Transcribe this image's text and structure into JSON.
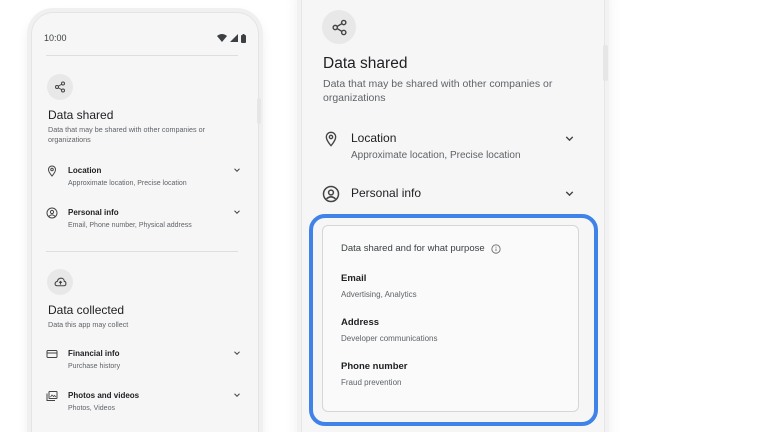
{
  "left_phone": {
    "status_time": "10:00",
    "data_shared": {
      "icon": "share-icon",
      "title": "Data shared",
      "subtitle": "Data that may be shared with other companies or organizations",
      "items": [
        {
          "icon": "location-pin-icon",
          "label": "Location",
          "detail": "Approximate location, Precise location"
        },
        {
          "icon": "account-circle-icon",
          "label": "Personal info",
          "detail": "Email, Phone number, Physical address"
        }
      ]
    },
    "data_collected": {
      "icon": "cloud-upload-icon",
      "title": "Data collected",
      "subtitle": "Data this app may collect",
      "items": [
        {
          "icon": "credit-card-icon",
          "label": "Financial info",
          "detail": "Purchase history"
        },
        {
          "icon": "photo-library-icon",
          "label": "Photos and videos",
          "detail": "Photos, Videos"
        }
      ]
    }
  },
  "right_phone": {
    "title": "Data shared",
    "subtitle": "Data that may be shared with other companies or organizations",
    "items": [
      {
        "icon": "location-pin-icon",
        "label": "Location",
        "detail": "Approximate location, Precise location"
      },
      {
        "icon": "account-circle-icon",
        "label": "Personal info"
      }
    ],
    "purpose_card": {
      "heading": "Data shared and for what purpose",
      "rows": [
        {
          "label": "Email",
          "detail": "Advertising, Analytics"
        },
        {
          "label": "Address",
          "detail": "Developer communications"
        },
        {
          "label": "Phone number",
          "detail": "Fraud prevention"
        }
      ]
    }
  },
  "colors": {
    "highlight": "#3f82e8",
    "background": "#ffffff",
    "phone_surface": "#f6f6f6"
  }
}
